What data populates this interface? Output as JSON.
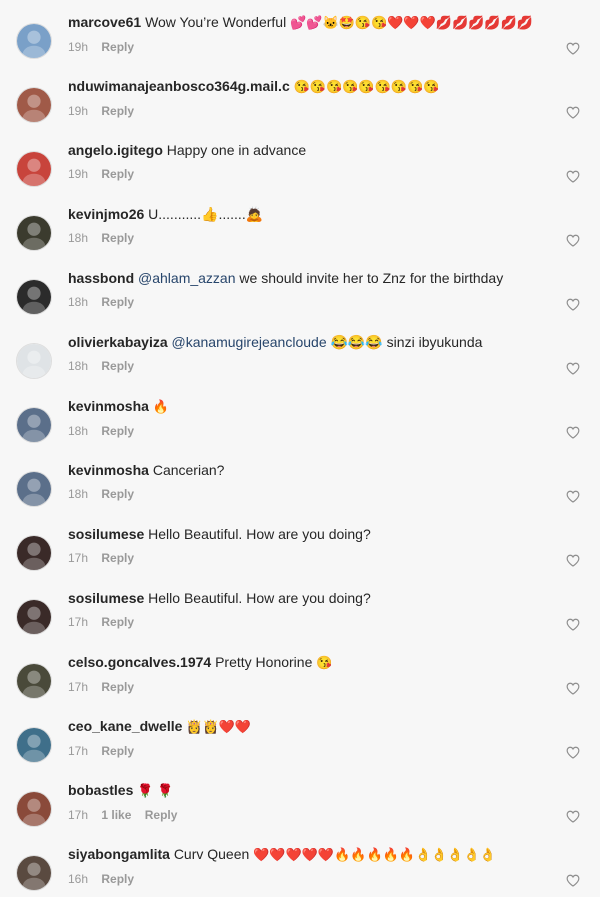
{
  "comments": [
    {
      "user": "marcove61",
      "mention": "",
      "text": "Wow You’re Wonderful",
      "emojis": "💕💕🐱🤩😘😘❤️❤️❤️💋💋💋💋💋💋",
      "time": "19h",
      "likes": "",
      "reply": "Reply",
      "avatar_color": "#7aa0c8"
    },
    {
      "user": "nduwimanajeanbosco364g.mail.c",
      "mention": "",
      "text": "",
      "emojis": "😘😘😘😘😘😘😘😘😘",
      "time": "19h",
      "likes": "",
      "reply": "Reply",
      "avatar_color": "#a05a48"
    },
    {
      "user": "angelo.igitego",
      "mention": "",
      "text": "Happy one in advance",
      "emojis": "",
      "time": "19h",
      "likes": "",
      "reply": "Reply",
      "avatar_color": "#c8443c"
    },
    {
      "user": "kevinjmo26",
      "mention": "",
      "text": "U...........👍.......🙇",
      "emojis": "",
      "time": "18h",
      "likes": "",
      "reply": "Reply",
      "avatar_color": "#3b3b2e"
    },
    {
      "user": "hassbond",
      "mention": "@ahlam_azzan",
      "text": "we should invite her to Znz for the birthday",
      "emojis": "",
      "time": "18h",
      "likes": "",
      "reply": "Reply",
      "avatar_color": "#2b2b2b"
    },
    {
      "user": "olivierkabayiza",
      "mention": "@kanamugirejeancloude",
      "text": "😂😂😂    sinzi ibyukunda",
      "emojis": "",
      "time": "18h",
      "likes": "",
      "reply": "Reply",
      "avatar_color": "#dfe3e6"
    },
    {
      "user": "kevinmosha",
      "mention": "",
      "text": "",
      "emojis": "🔥",
      "time": "18h",
      "likes": "",
      "reply": "Reply",
      "avatar_color": "#5b6f8a"
    },
    {
      "user": "kevinmosha",
      "mention": "",
      "text": "Cancerian?",
      "emojis": "",
      "time": "18h",
      "likes": "",
      "reply": "Reply",
      "avatar_color": "#5b6f8a"
    },
    {
      "user": "sosilumese",
      "mention": "",
      "text": "Hello Beautiful. How are you doing?",
      "emojis": "",
      "time": "17h",
      "likes": "",
      "reply": "Reply",
      "avatar_color": "#3a2a28"
    },
    {
      "user": "sosilumese",
      "mention": "",
      "text": "Hello Beautiful. How are you doing?",
      "emojis": "",
      "time": "17h",
      "likes": "",
      "reply": "Reply",
      "avatar_color": "#3a2a28"
    },
    {
      "user": "celso.goncalves.1974",
      "mention": "",
      "text": "Pretty Honorine",
      "emojis": "😘",
      "time": "17h",
      "likes": "",
      "reply": "Reply",
      "avatar_color": "#4a4a3a"
    },
    {
      "user": "ceo_kane_dwelle",
      "mention": "",
      "text": "",
      "emojis": "👸👸❤️❤️",
      "time": "17h",
      "likes": "",
      "reply": "Reply",
      "avatar_color": "#3f6f8a"
    },
    {
      "user": "bobastles",
      "mention": "",
      "text": "",
      "emojis": "🌹 🌹",
      "time": "17h",
      "likes": "1 like",
      "reply": "Reply",
      "avatar_color": "#8a4a3a"
    },
    {
      "user": "siyabongamlita",
      "mention": "",
      "text": "Curv Queen",
      "emojis": "❤️❤️❤️❤️❤️🔥🔥🔥🔥🔥👌👌👌👌👌",
      "time": "16h",
      "likes": "",
      "reply": "Reply",
      "avatar_color": "#5a4a40"
    }
  ],
  "icons": {
    "like": "heart-outline-icon"
  },
  "colors": {
    "mention": "#27456b",
    "meta": "#999999",
    "background": "#f7f7f7"
  }
}
